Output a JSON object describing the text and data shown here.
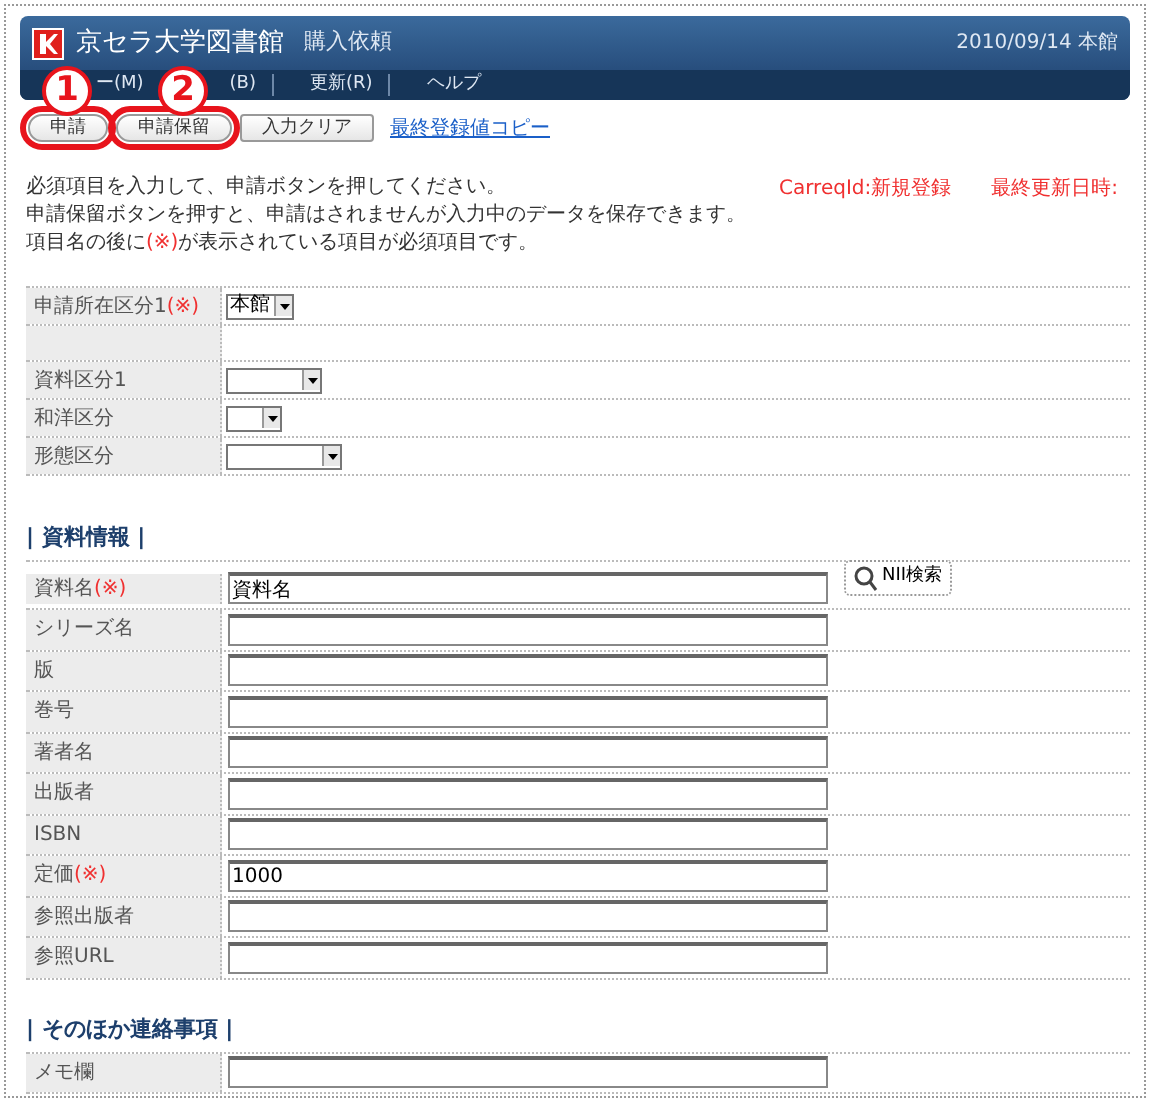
{
  "header": {
    "title": "京セラ大学図書館",
    "subtitle": "購入依頼",
    "date_branch": "2010/09/14 本館"
  },
  "menu": [
    {
      "label": "ー(M)"
    },
    {
      "label": "(B)"
    },
    {
      "label": "更新(R)"
    },
    {
      "label": "ヘルプ"
    }
  ],
  "annotations": [
    {
      "number": "1"
    },
    {
      "number": "2"
    }
  ],
  "toolbar": {
    "buttons": [
      {
        "label": "申請",
        "circled": true
      },
      {
        "label": "申請保留",
        "circled": true
      },
      {
        "label": "入力クリア",
        "circled": false
      }
    ],
    "link": "最終登録値コピー"
  },
  "instructions": [
    [
      {
        "text": "必須項目を入力して、申請ボタンを押してください。",
        "kind": "plain"
      }
    ],
    [
      {
        "text": "申請保留ボタンを押すと、申請はされませんが入力中のデータを保存できます。",
        "kind": "plain"
      }
    ],
    [
      {
        "text": "項目名の後に",
        "kind": "plain"
      },
      {
        "text": "(※)",
        "kind": "required"
      },
      {
        "text": "が表示されている項目が必須項目です。",
        "kind": "plain"
      }
    ]
  ],
  "status": {
    "carreq_id": "CarreqId:新規登録",
    "last_updated": "最終更新日時:"
  },
  "form_top": [
    {
      "kind": "select",
      "label": "申請所在区分1",
      "mark": "(※)",
      "value": "本館"
    },
    {
      "kind": "blank"
    },
    {
      "kind": "select",
      "label": "資料区分1"
    },
    {
      "kind": "select",
      "label": "和洋区分"
    },
    {
      "kind": "select",
      "label": "形態区分"
    }
  ],
  "sections": [
    {
      "title": "| 資料情報 |",
      "rows": [
        {
          "label": "資料名",
          "mark": "(※)",
          "value": "資料名",
          "button": "NII検索"
        },
        {
          "label": "シリーズ名",
          "value": ""
        },
        {
          "label": "版",
          "value": ""
        },
        {
          "label": "巻号",
          "value": ""
        },
        {
          "label": "著者名",
          "value": ""
        },
        {
          "label": "出版者",
          "value": ""
        },
        {
          "label": "ISBN",
          "value": ""
        },
        {
          "label": "定価",
          "mark": "(※)",
          "value": "1000"
        },
        {
          "label": "参照出版者",
          "value": ""
        },
        {
          "label": "参照URL",
          "value": ""
        }
      ]
    },
    {
      "title": "| そのほか連絡事項 |",
      "rows": [
        {
          "label": "メモ欄",
          "value": ""
        }
      ]
    }
  ]
}
